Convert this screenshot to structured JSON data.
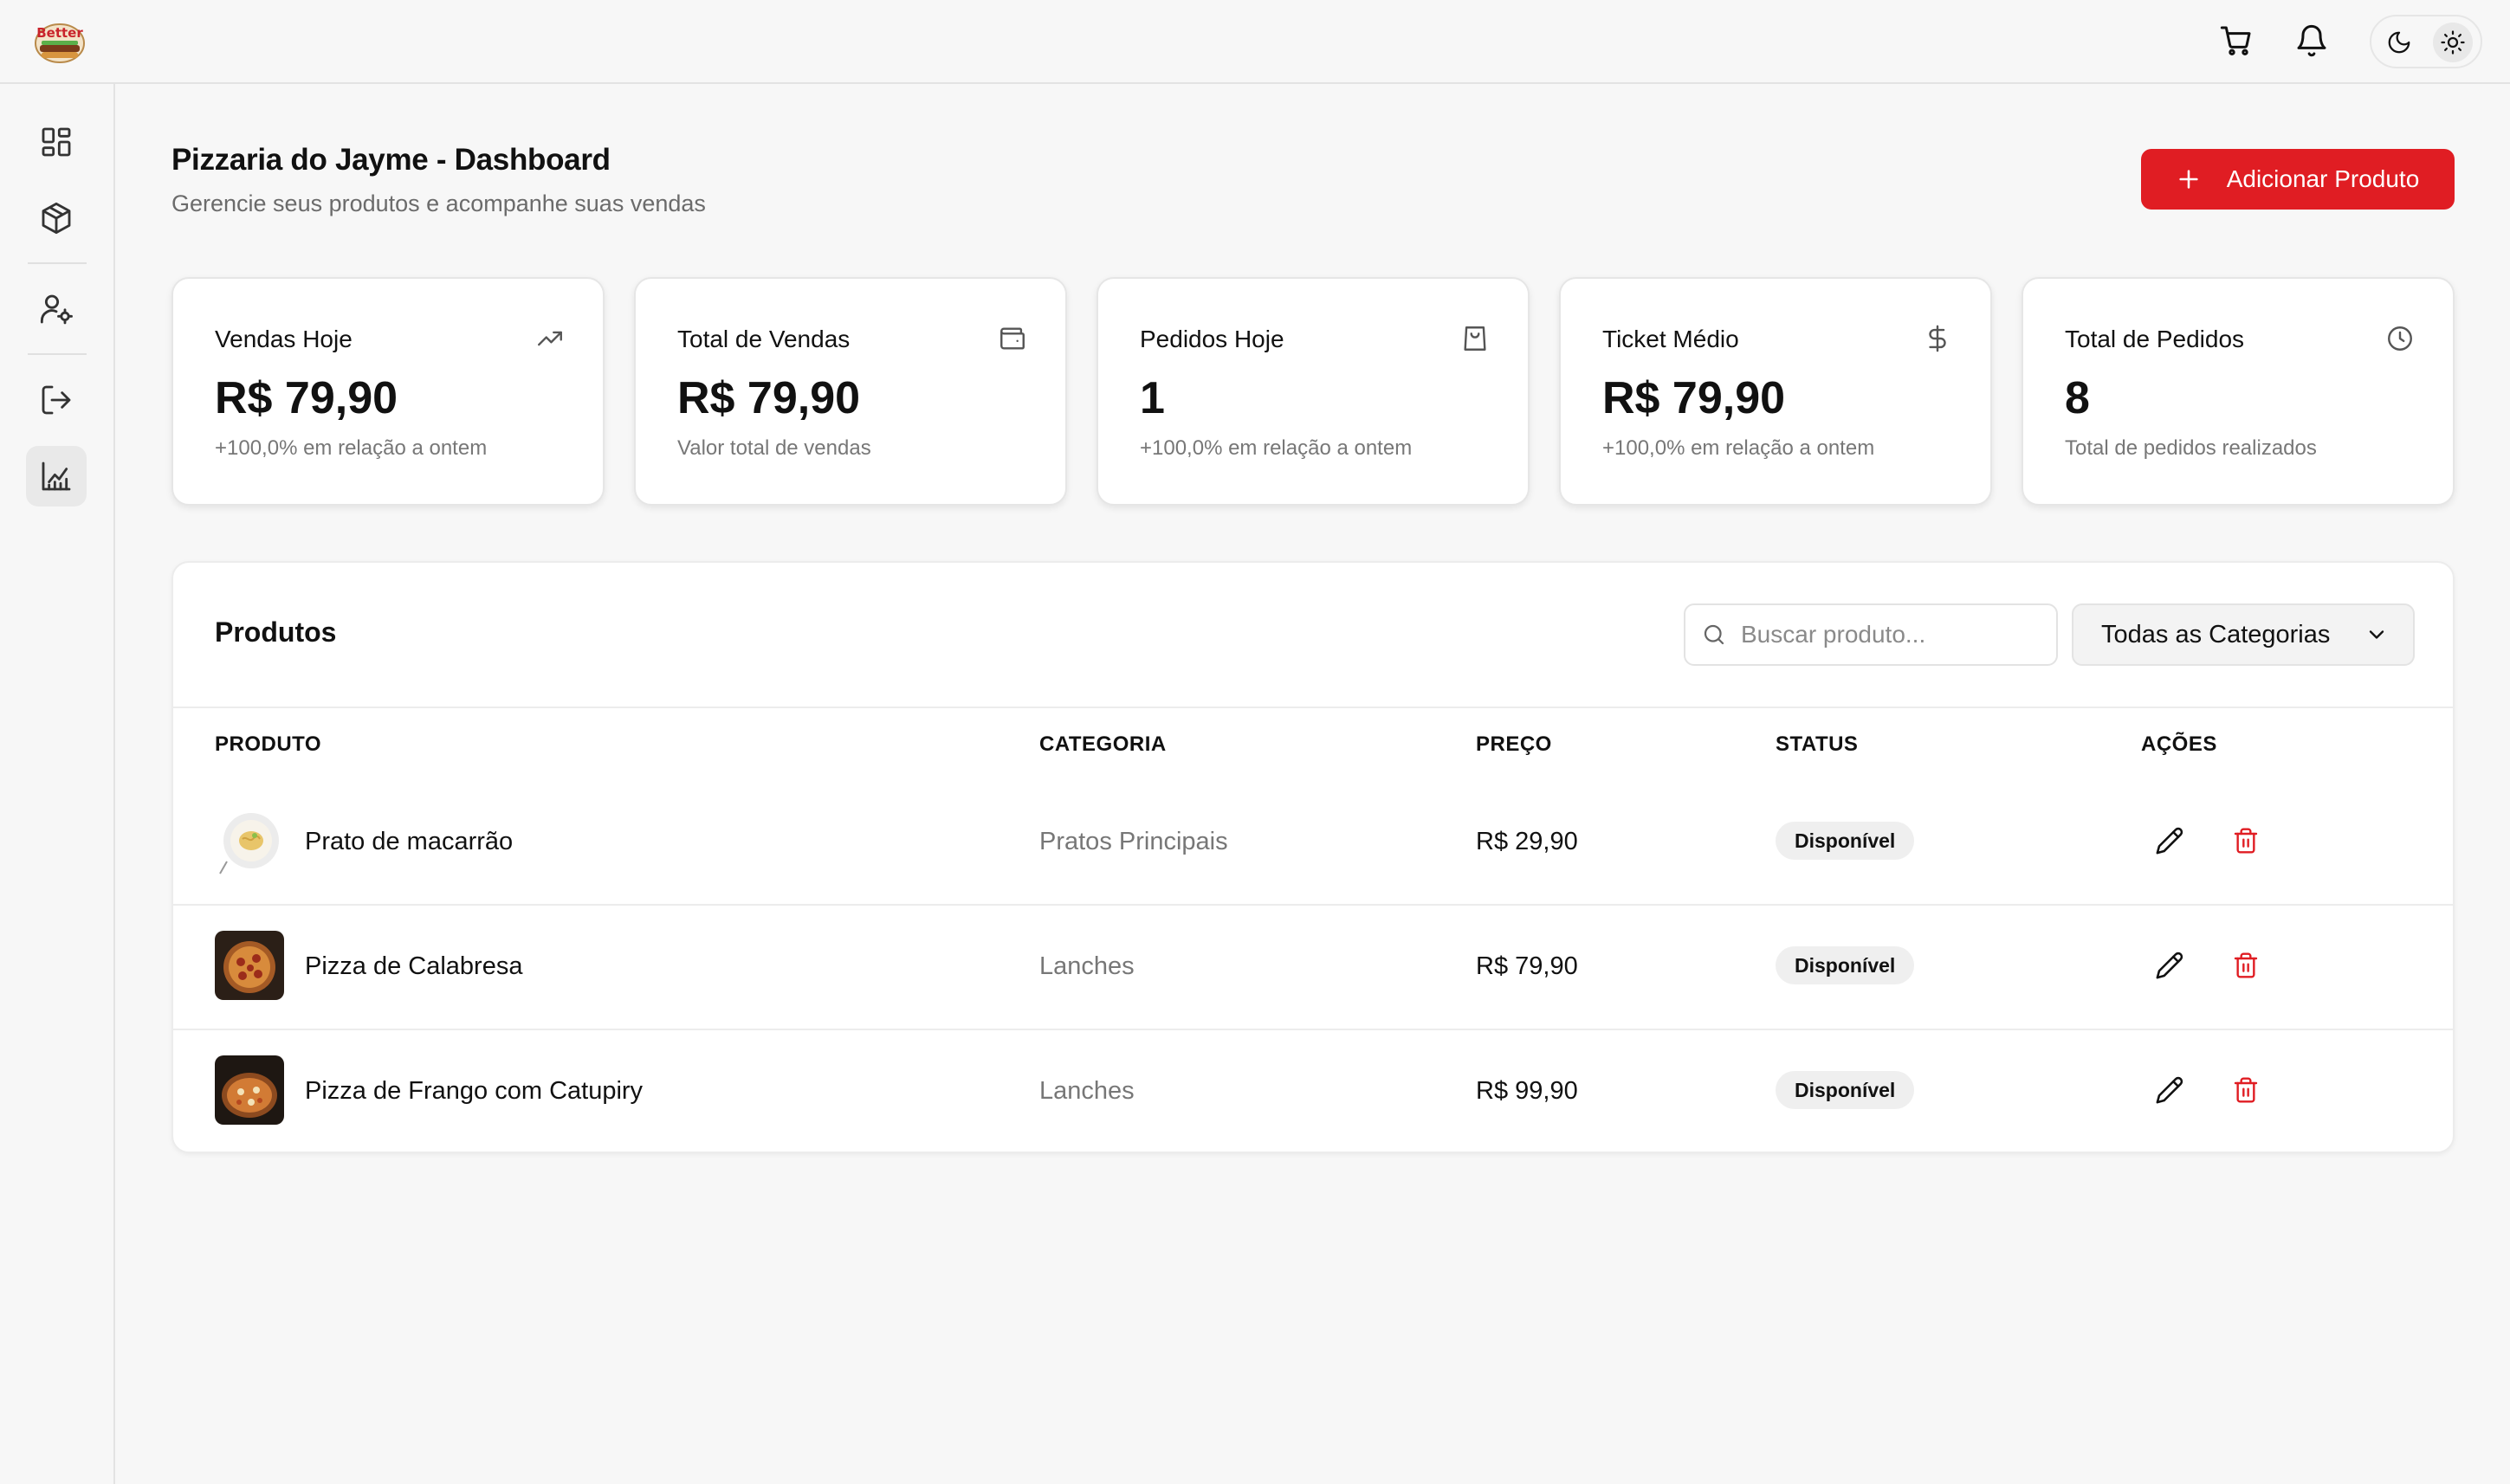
{
  "app": {
    "logo_text": "Better"
  },
  "header": {
    "title": "Pizzaria do Jayme - Dashboard",
    "subtitle": "Gerencie seus produtos e acompanhe suas vendas",
    "add_button_label": "Adicionar Produto"
  },
  "topbar": {
    "icons": [
      "cart-icon",
      "bell-icon",
      "moon-icon",
      "sun-icon"
    ]
  },
  "sidebar": {
    "items": [
      {
        "icon": "dashboard-icon"
      },
      {
        "icon": "box-icon"
      },
      {
        "icon": "user-settings-icon"
      },
      {
        "icon": "logout-icon"
      },
      {
        "icon": "chart-icon",
        "active": true
      }
    ]
  },
  "stats": [
    {
      "title": "Vendas Hoje",
      "value": "R$ 79,90",
      "note": "+100,0% em relação a ontem",
      "icon": "trending-up-icon"
    },
    {
      "title": "Total de Vendas",
      "value": "R$ 79,90",
      "note": "Valor total de vendas",
      "icon": "wallet-icon"
    },
    {
      "title": "Pedidos Hoje",
      "value": "1",
      "note": "+100,0% em relação a ontem",
      "icon": "shopping-bag-icon"
    },
    {
      "title": "Ticket Médio",
      "value": "R$ 79,90",
      "note": "+100,0% em relação a ontem",
      "icon": "dollar-icon"
    },
    {
      "title": "Total de Pedidos",
      "value": "8",
      "note": "Total de pedidos realizados",
      "icon": "clock-icon"
    }
  ],
  "products": {
    "title": "Produtos",
    "search_placeholder": "Buscar produto...",
    "category_filter": "Todas as Categorias",
    "columns": [
      "PRODUTO",
      "CATEGORIA",
      "PREÇO",
      "STATUS",
      "AÇÕES"
    ],
    "rows": [
      {
        "name": "Prato de macarrão",
        "category": "Pratos Principais",
        "price": "R$ 29,90",
        "status": "Disponível"
      },
      {
        "name": "Pizza de Calabresa",
        "category": "Lanches",
        "price": "R$ 79,90",
        "status": "Disponível"
      },
      {
        "name": "Pizza de Frango com Catupiry",
        "category": "Lanches",
        "price": "R$ 99,90",
        "status": "Disponível"
      }
    ]
  },
  "colors": {
    "accent": "#e01d23",
    "background": "#f7f7f7",
    "card": "#ffffff"
  }
}
